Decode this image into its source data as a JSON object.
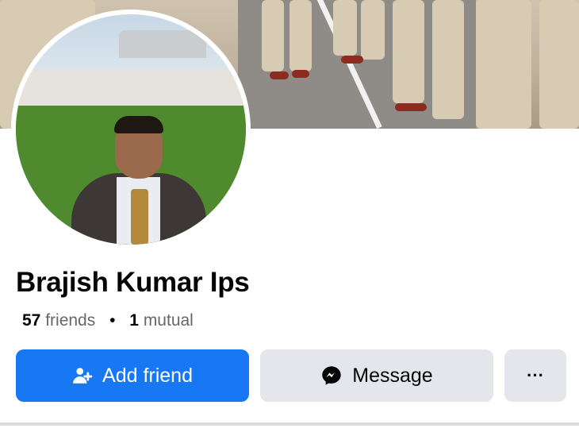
{
  "profile": {
    "name": "Brajish Kumar Ips",
    "friends_count": "57",
    "friends_label": "friends",
    "separator": "•",
    "mutual_count": "1",
    "mutual_label": "mutual"
  },
  "actions": {
    "add_friend_label": "Add friend",
    "message_label": "Message",
    "more_label": "···"
  },
  "icons": {
    "add_friend": "person-plus-icon",
    "message": "messenger-icon"
  },
  "colors": {
    "primary": "#1877f2",
    "secondary": "#e4e6eb",
    "text": "#050505",
    "muted": "#65676b"
  }
}
